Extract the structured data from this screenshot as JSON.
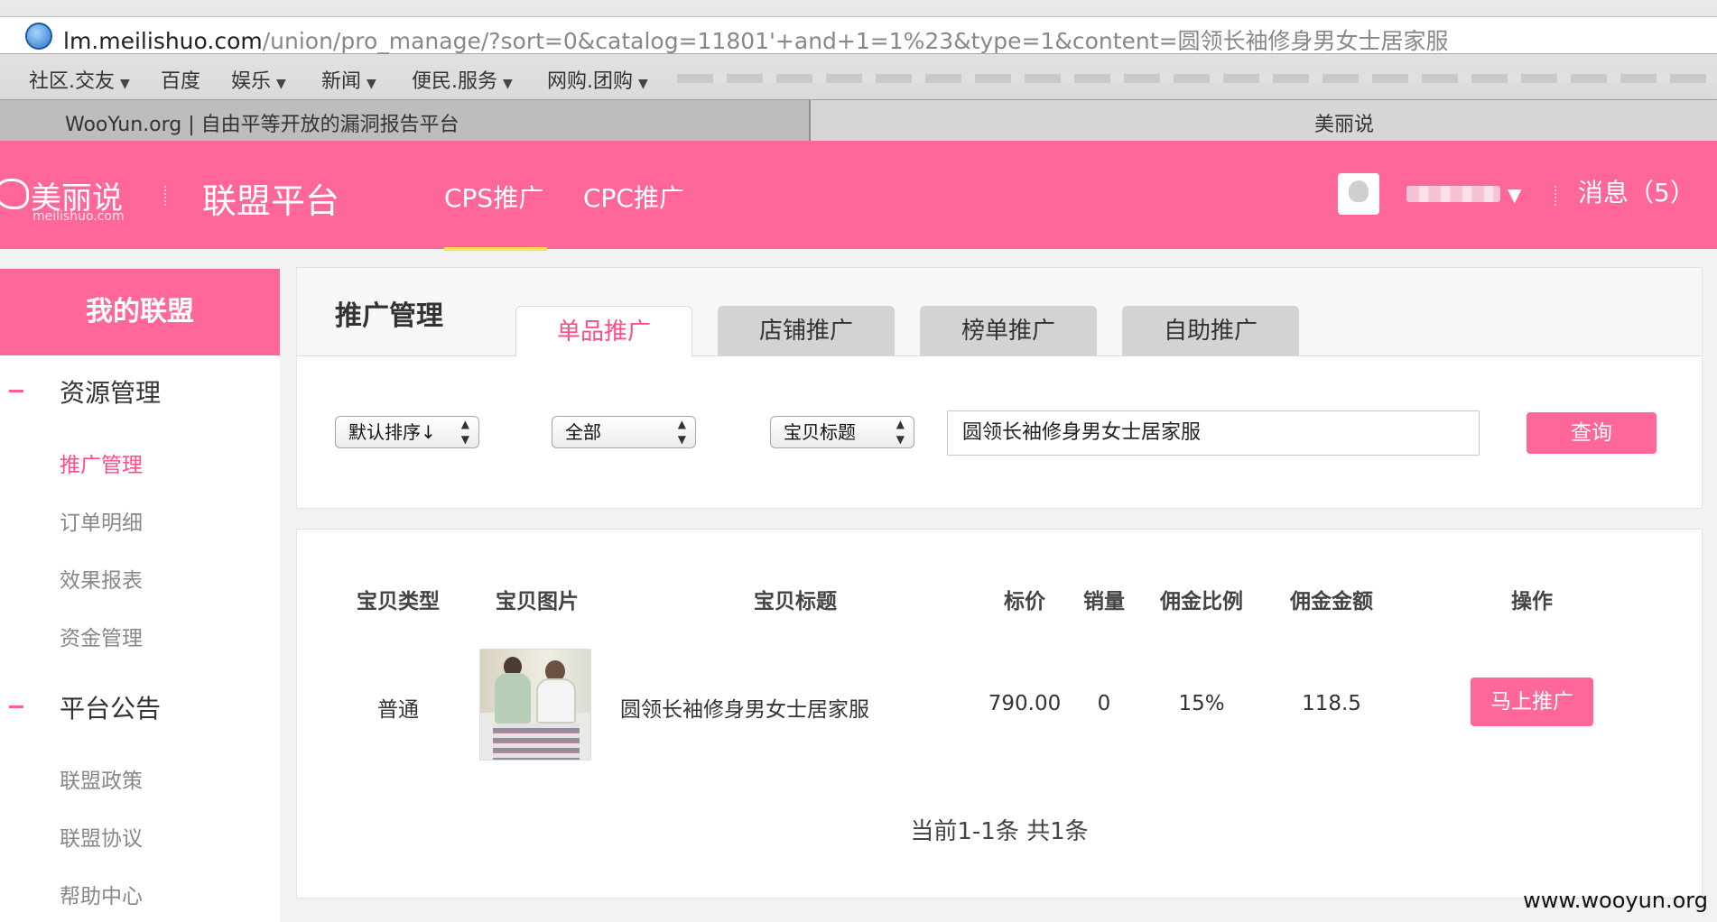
{
  "browser": {
    "url_host": "lm.meilishuo.com",
    "url_path": "/union/pro_manage/?sort=0&catalog=11801'+and+1=1%23&type=1&content=圆领长袖修身男女士居家服",
    "bookmarks": [
      {
        "label": "社区.交友"
      },
      {
        "label": "百度"
      },
      {
        "label": "娱乐"
      },
      {
        "label": "新闻"
      },
      {
        "label": "便民.服务"
      },
      {
        "label": "网购.团购"
      }
    ],
    "tabs": [
      {
        "label": "WooYun.org | 自由平等开放的漏洞报告平台"
      },
      {
        "label": "美丽说"
      }
    ]
  },
  "header": {
    "logo_text": "美丽说",
    "logo_sub": "meilishuo.com",
    "platform_title": "联盟平台",
    "nav": [
      {
        "label": "CPS推广"
      },
      {
        "label": "CPC推广"
      }
    ],
    "messages": "消息（5）"
  },
  "sidebar": {
    "title": "我的联盟",
    "sections": [
      {
        "title": "资源管理",
        "items": [
          {
            "label": "推广管理"
          },
          {
            "label": "订单明细"
          },
          {
            "label": "效果报表"
          },
          {
            "label": "资金管理"
          }
        ]
      },
      {
        "title": "平台公告",
        "items": [
          {
            "label": "联盟政策"
          },
          {
            "label": "联盟协议"
          },
          {
            "label": "帮助中心"
          }
        ]
      }
    ]
  },
  "main": {
    "title": "推广管理",
    "tabs": [
      {
        "label": "单品推广"
      },
      {
        "label": "店铺推广"
      },
      {
        "label": "榜单推广"
      },
      {
        "label": "自助推广"
      }
    ],
    "filters": {
      "sort": "默认排序↓",
      "category": "全部",
      "field": "宝贝标题",
      "search_value": "圆领长袖修身男女士居家服",
      "query_label": "查询"
    },
    "table": {
      "columns": [
        "宝贝类型",
        "宝贝图片",
        "宝贝标题",
        "标价",
        "销量",
        "佣金比例",
        "佣金金额",
        "操作"
      ],
      "rows": [
        {
          "type": "普通",
          "title": "圆领长袖修身男女士居家服",
          "price": "790.00",
          "sales": "0",
          "commission_rate": "15%",
          "commission_amount": "118.5",
          "action": "马上推广"
        }
      ]
    },
    "pagination": "当前1-1条 共1条"
  },
  "watermark": "www.wooyun.org"
}
